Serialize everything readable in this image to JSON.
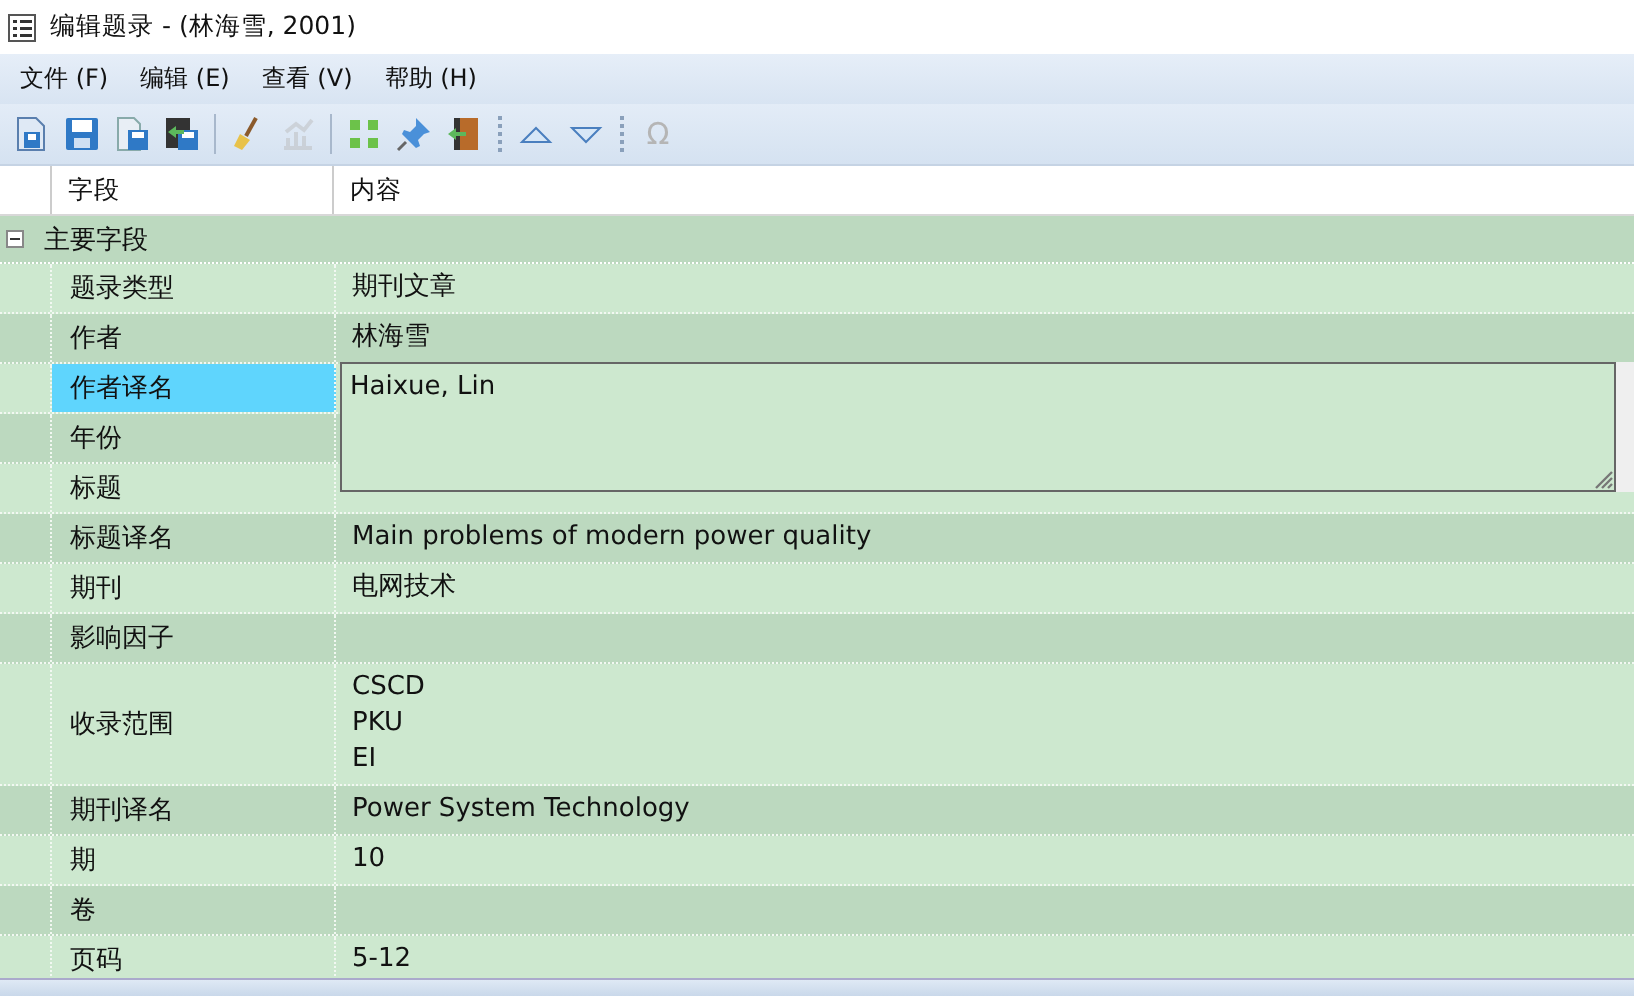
{
  "window": {
    "title": "编辑题录 - (林海雪, 2001)"
  },
  "menu": [
    "文件 (F)",
    "编辑 (E)",
    "查看 (V)",
    "帮助 (H)"
  ],
  "toolbar": [
    {
      "kind": "new-doc"
    },
    {
      "kind": "save"
    },
    {
      "kind": "save-copy"
    },
    {
      "kind": "save-exit"
    },
    {
      "kind": "separator"
    },
    {
      "kind": "broom"
    },
    {
      "kind": "chart",
      "disabled": true
    },
    {
      "kind": "separator"
    },
    {
      "kind": "grid"
    },
    {
      "kind": "pin"
    },
    {
      "kind": "exit"
    },
    {
      "kind": "dots"
    },
    {
      "kind": "up"
    },
    {
      "kind": "down"
    },
    {
      "kind": "dots"
    },
    {
      "kind": "omega",
      "label": "Ω",
      "disabled": true
    }
  ],
  "table": {
    "columns": [
      "字段",
      "内容"
    ],
    "group": {
      "label": "主要字段",
      "expanded": true
    },
    "rows": [
      {
        "field": "题录类型",
        "lines": [
          "期刊文章"
        ],
        "selected": false
      },
      {
        "field": "作者",
        "lines": [
          "林海雪"
        ],
        "selected": false
      },
      {
        "field": "作者译名",
        "lines": [],
        "selected": true
      },
      {
        "field": "年份",
        "lines": [],
        "selected": false
      },
      {
        "field": "标题",
        "lines": [],
        "selected": false
      },
      {
        "field": "标题译名",
        "lines": [
          "Main problems of modern power quality"
        ],
        "selected": false
      },
      {
        "field": "期刊",
        "lines": [
          "电网技术"
        ],
        "selected": false
      },
      {
        "field": "影响因子",
        "lines": [],
        "selected": false
      },
      {
        "field": "收录范围",
        "lines": [
          "CSCD",
          "PKU",
          "EI"
        ],
        "selected": false
      },
      {
        "field": "期刊译名",
        "lines": [
          "Power System Technology"
        ],
        "selected": false
      },
      {
        "field": "期",
        "lines": [
          "10"
        ],
        "selected": false
      },
      {
        "field": "卷",
        "lines": [],
        "selected": false
      },
      {
        "field": "页码",
        "lines": [
          "5-12"
        ],
        "selected": false
      }
    ]
  },
  "editor": {
    "value": "Haixue, Lin"
  }
}
